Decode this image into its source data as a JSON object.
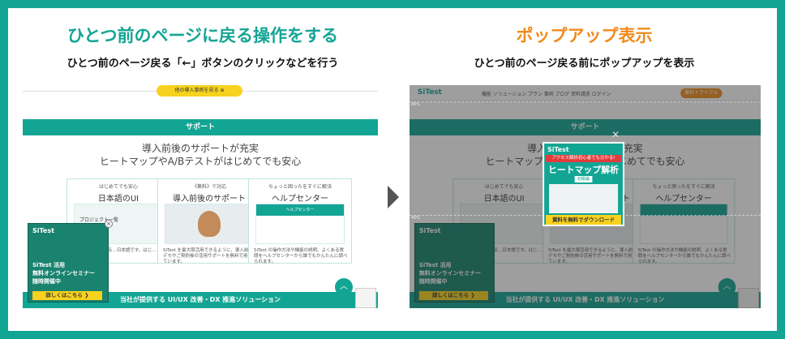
{
  "left": {
    "title": "ひとつ前のページに戻る操作をする",
    "subtitle": "ひとつ前のページ戻る「←」ボタンのクリックなどを行う"
  },
  "right": {
    "title": "ポップアップ表示",
    "subtitle": "ひとつ前のページ戻る前にポップアップを表示"
  },
  "site": {
    "yellow_button": "他の導入事例を見る ⊕",
    "section_label": "サポート",
    "heading_line1": "導入前後のサポートが充実",
    "heading_line2": "ヒートマップやA/Bテストがはじめてでも安心",
    "cards": [
      {
        "small": "はじめてでも安心",
        "title": "日本語のUI",
        "desc": "…手・運営している…日本語です。はじ…して利用できます。"
      },
      {
        "small": "《無料》で対応",
        "title": "導入前後のサポート",
        "desc": "SiTest を最大限活用できるように、導入前のデモやご契約後の活用サポートを無料で用意しています。"
      },
      {
        "small": "ちょっと困ったをすぐに解決",
        "title": "ヘルプセンター",
        "desc": "SiTest の操作方法や機能の説明、よくある質問をヘルプセンターから誰でもかんたんに調べられます。"
      }
    ],
    "help_center_label": "ヘルプセンター",
    "bottom_bar": "当社が提供する UI/UX 改善・DX 推進ソリューション",
    "banner": {
      "logo": "SiTest",
      "line1": "SiTest 活用",
      "line2": "無料オンラインセミナー",
      "line3": "随時開催中",
      "button": "詳しくはこちら ❯"
    },
    "nav": {
      "brand": "SiTest",
      "links": "機能   ソリューション   プラン   事例   ブログ   資料請求   ログイン",
      "trial": "無料トライアル"
    },
    "project_label": "プロジェクト一覧"
  },
  "popup": {
    "logo": "SiTest",
    "red_text": "アクセス解析初心者でも分かる!",
    "title": "ヒートマップ解析",
    "beginner": "初級編",
    "button": "資料を無料でダウンロード"
  },
  "markers": {
    "top_pct": "40%",
    "mid_pct": "45%"
  }
}
